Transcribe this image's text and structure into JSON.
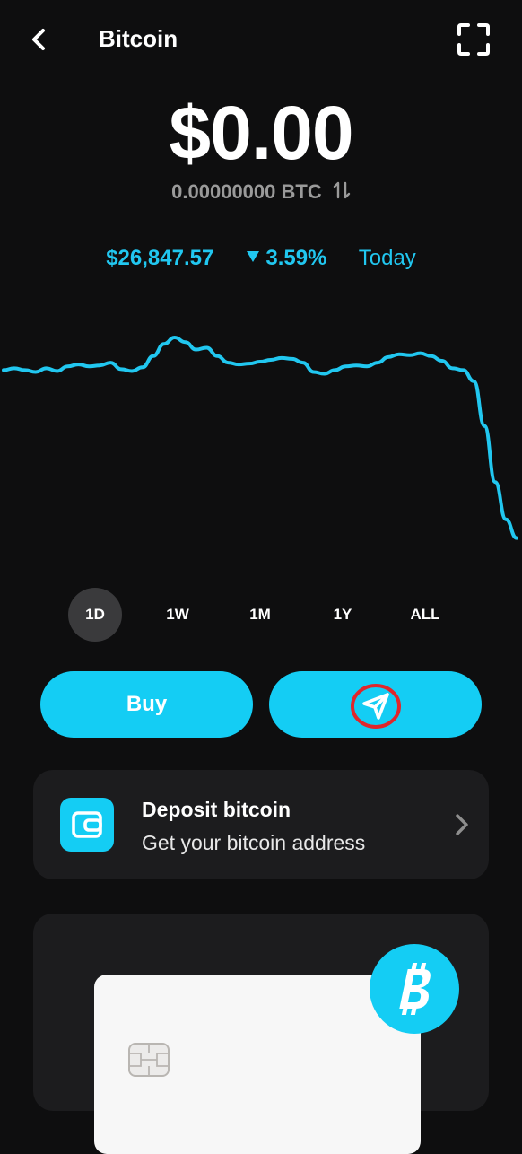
{
  "header": {
    "title": "Bitcoin"
  },
  "balance": {
    "usd": "$0.00",
    "btc": "0.00000000 BTC"
  },
  "price": {
    "value": "$26,847.57",
    "change": "3.59%",
    "direction": "down",
    "period": "Today"
  },
  "chart_data": {
    "type": "line",
    "x": [
      0,
      1,
      2,
      3,
      4,
      5,
      6,
      7,
      8,
      9,
      10,
      11,
      12,
      13,
      14,
      15,
      16,
      17,
      18,
      19,
      20,
      21,
      22,
      23,
      24,
      25,
      26,
      27,
      28,
      29,
      30,
      31,
      32,
      33,
      34,
      35,
      36,
      37,
      38,
      39,
      40,
      41,
      42,
      43,
      44,
      45,
      46,
      47,
      48
    ],
    "series": [
      {
        "values": [
          40,
          42,
          40,
          38,
          42,
          39,
          44,
          46,
          44,
          45,
          48,
          41,
          39,
          43,
          55,
          68,
          75,
          70,
          62,
          64,
          55,
          48,
          46,
          47,
          49,
          51,
          53,
          52,
          48,
          38,
          36,
          40,
          44,
          45,
          44,
          48,
          54,
          57,
          56,
          58,
          55,
          50,
          42,
          40,
          28,
          -20,
          -80,
          -120,
          -140
        ]
      }
    ],
    "ylim": [
      -150,
      100
    ],
    "color": "#21c7f0"
  },
  "ranges": [
    "1D",
    "1W",
    "1M",
    "1Y",
    "ALL"
  ],
  "active_range": "1D",
  "actions": {
    "buy_label": "Buy",
    "send_icon": "send-icon"
  },
  "deposit": {
    "title": "Deposit bitcoin",
    "subtitle": "Get your bitcoin address",
    "icon": "wallet-icon"
  },
  "colors": {
    "accent": "#14cdf4",
    "price": "#21c7f0",
    "bg": "#0e0e0f",
    "card": "#1c1c1e"
  }
}
